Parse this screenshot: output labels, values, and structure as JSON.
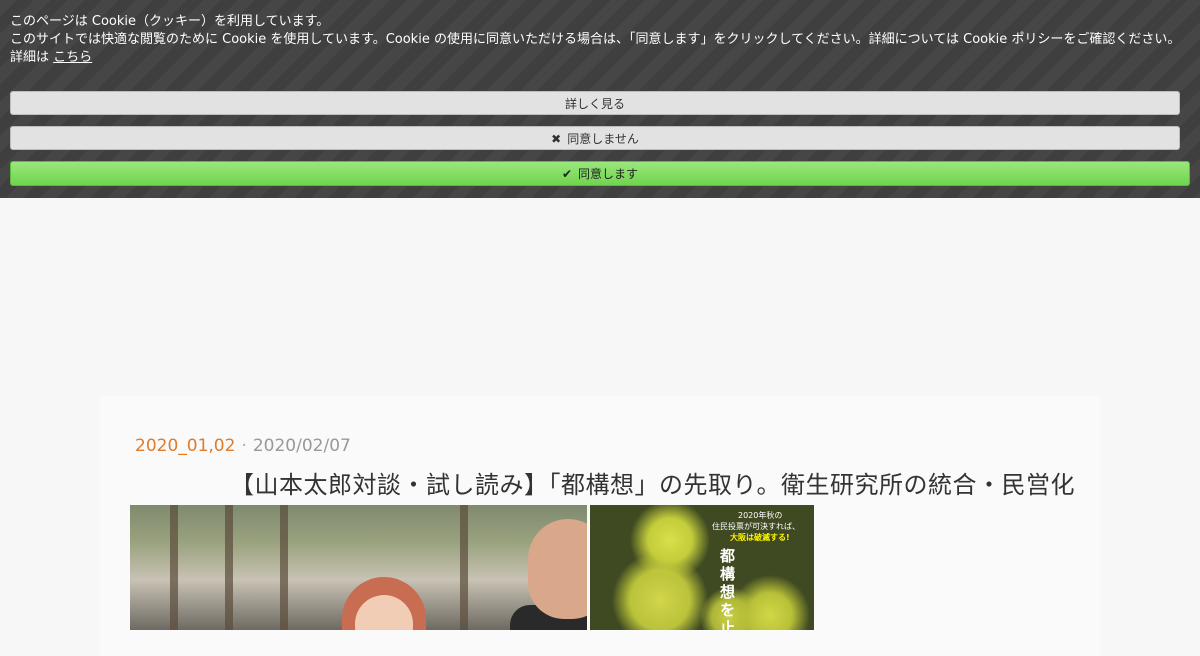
{
  "cookie_banner": {
    "line1": "このページは Cookie（クッキー）を利用しています。",
    "line2": "このサイトでは快適な閲覧のために Cookie を使用しています。Cookie の使用に同意いただける場合は、「同意します」をクリックしてください。詳細については Cookie ポリシーをご確認ください。",
    "line3_prefix": "詳細は",
    "line3_link": "こちら",
    "learn_more_label": "詳しく見る",
    "decline_icon": "close-x-icon",
    "decline_label": "同意しません",
    "accept_icon": "checkmark-icon",
    "accept_label": "同意します",
    "accept_color": "#7ddc5e"
  },
  "article": {
    "category": "2020_01,02",
    "separator": "·",
    "date": "2020/02/07",
    "title": "【山本太郎対談・試し読み】「都構想」の先取り。衛生研究所の統合・民営化",
    "category_color": "#e07b2a"
  },
  "book_cover": {
    "caption1": "2020年秋の",
    "caption2": "住民投票が可決すれば、",
    "caption3": "大阪は破滅する!",
    "vertical_title": "都構想を止め"
  }
}
